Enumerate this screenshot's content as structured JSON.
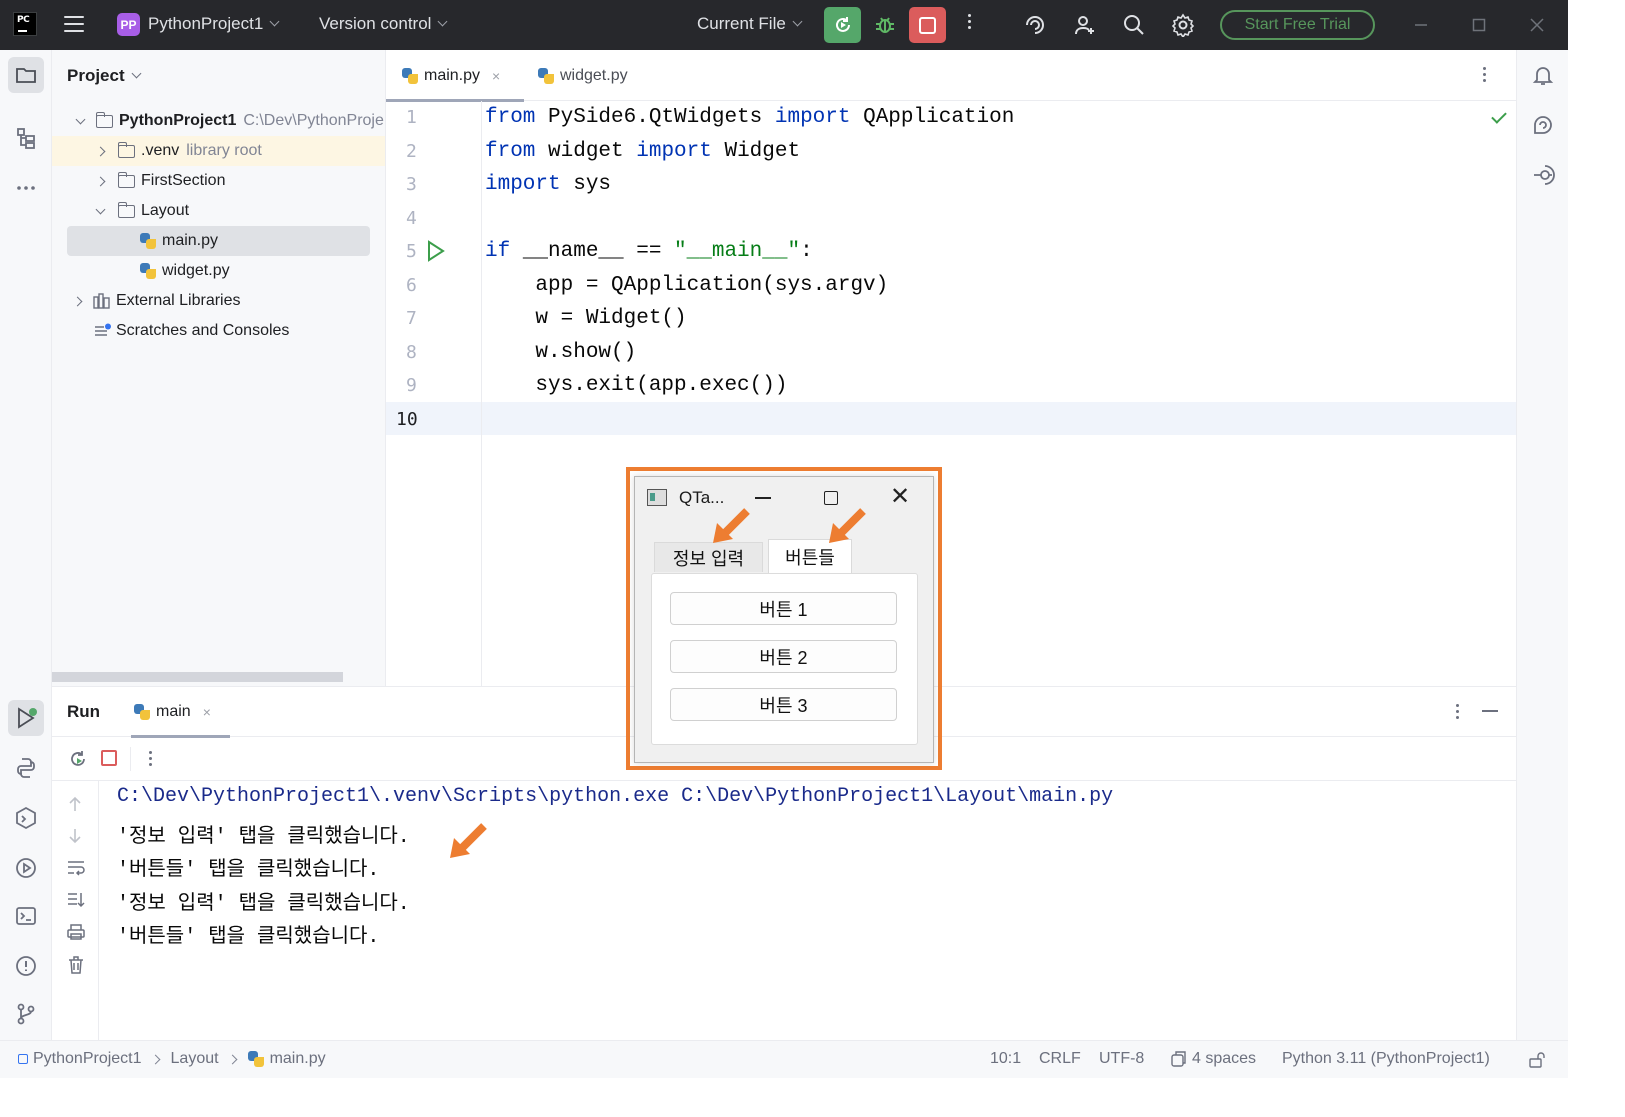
{
  "titlebar": {
    "logo_text": "PC",
    "project_badge": "PP",
    "project_name": "PythonProject1",
    "version_control": "Version control",
    "current_file": "Current File",
    "trial_button": "Start Free Trial"
  },
  "project_panel": {
    "title": "Project",
    "tree": [
      {
        "label": "PythonProject1",
        "extra": "C:\\Dev\\PythonProje"
      },
      {
        "label": ".venv",
        "extra": "library root"
      },
      {
        "label": "FirstSection"
      },
      {
        "label": "Layout"
      },
      {
        "label": "main.py"
      },
      {
        "label": "widget.py"
      },
      {
        "label": "External Libraries"
      },
      {
        "label": "Scratches and Consoles"
      }
    ]
  },
  "editor": {
    "tabs": [
      {
        "label": "main.py",
        "close": "×"
      },
      {
        "label": "widget.py"
      }
    ],
    "line_numbers": [
      "1",
      "2",
      "3",
      "4",
      "5",
      "6",
      "7",
      "8",
      "9",
      "10"
    ],
    "code": {
      "l1_from": "from",
      "l1_mod": " PySide6.QtWidgets ",
      "l1_import": "import",
      "l1_name": " QApplication",
      "l2_from": "from",
      "l2_mod": " widget ",
      "l2_import": "import",
      "l2_name": " Widget",
      "l3_import": "import",
      "l3_name": " sys",
      "l5_if": "if",
      "l5_mid": " __name__ == ",
      "l5_str": "\"__main__\"",
      "l5_end": ":",
      "l6": "    app = QApplication(sys.argv)",
      "l7": "    w = Widget()",
      "l8": "    w.show()",
      "l9": "    sys.exit(app.exec())"
    }
  },
  "run_panel": {
    "title": "Run",
    "tab_label": "main",
    "tab_close": "×",
    "output": [
      "C:\\Dev\\PythonProject1\\.venv\\Scripts\\python.exe C:\\Dev\\PythonProject1\\Layout\\main.py",
      "'정보 입력' 탭을 클릭했습니다.",
      "'버튼들' 탭을 클릭했습니다.",
      "'정보 입력' 탭을 클릭했습니다.",
      "'버튼들' 탭을 클릭했습니다."
    ]
  },
  "qt_window": {
    "title": "QTa...",
    "close_glyph": "✕",
    "tabs": [
      "정보 입력",
      "버튼들"
    ],
    "buttons": [
      "버튼 1",
      "버튼 2",
      "버튼 3"
    ]
  },
  "statusbar": {
    "breadcrumb": [
      "PythonProject1",
      "Layout",
      "main.py"
    ],
    "position": "10:1",
    "line_sep": "CRLF",
    "encoding": "UTF-8",
    "indent": "4 spaces",
    "interpreter": "Python 3.11 (PythonProject1)"
  },
  "colors": {
    "accent_orange": "#ed7d31",
    "run_green": "#55a76a",
    "stop_red": "#db5c5c",
    "keyword_blue": "#0033b3",
    "string_green": "#067d17"
  }
}
